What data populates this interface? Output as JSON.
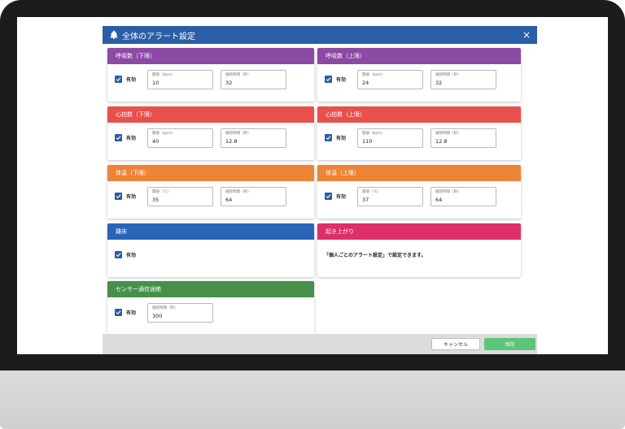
{
  "colors": {
    "title_bar": "#2a5ea6",
    "respiration": "#8a4aa5",
    "heart": "#e8504c",
    "temperature": "#ee8436",
    "bed_leave": "#2a64b8",
    "getting_up": "#dd2f6a",
    "sensor": "#45904a",
    "save": "#5cc57a"
  },
  "dialog": {
    "title": "全体のアラート設定",
    "close_glyph": "×"
  },
  "cards": {
    "resp_low": {
      "title": "呼吸数（下限）",
      "enabled_label": "有効",
      "fields": [
        {
          "label": "閾値（bpm）",
          "value": "10"
        },
        {
          "label": "継続時間（秒）",
          "value": "32"
        }
      ]
    },
    "resp_high": {
      "title": "呼吸数（上限）",
      "enabled_label": "有効",
      "fields": [
        {
          "label": "閾値（bpm）",
          "value": "24"
        },
        {
          "label": "継続時間（秒）",
          "value": "32"
        }
      ]
    },
    "heart_low": {
      "title": "心拍数（下限）",
      "enabled_label": "有効",
      "fields": [
        {
          "label": "閾値（bpm）",
          "value": "40"
        },
        {
          "label": "継続時間（秒）",
          "value": "12.8"
        }
      ]
    },
    "heart_high": {
      "title": "心拍数（上限）",
      "enabled_label": "有効",
      "fields": [
        {
          "label": "閾値（bpm）",
          "value": "110"
        },
        {
          "label": "継続時間（秒）",
          "value": "12.8"
        }
      ]
    },
    "temp_low": {
      "title": "体温（下限）",
      "enabled_label": "有効",
      "fields": [
        {
          "label": "閾値（℃）",
          "value": "35"
        },
        {
          "label": "継続時間（秒）",
          "value": "64"
        }
      ]
    },
    "temp_high": {
      "title": "体温（上限）",
      "enabled_label": "有効",
      "fields": [
        {
          "label": "閾値（℃）",
          "value": "37"
        },
        {
          "label": "継続時間（秒）",
          "value": "64"
        }
      ]
    },
    "bed_leave": {
      "title": "離床",
      "enabled_label": "有効"
    },
    "getting_up": {
      "title": "起き上がり",
      "note": "「個人ごとのアラート設定」で設定できます。"
    },
    "sensor": {
      "title": "センサー通信途絶",
      "enabled_label": "有効",
      "fields": [
        {
          "label": "継続時間（秒）",
          "value": "300"
        }
      ]
    }
  },
  "footer": {
    "cancel_label": "キャンセル",
    "save_label": "保存"
  }
}
